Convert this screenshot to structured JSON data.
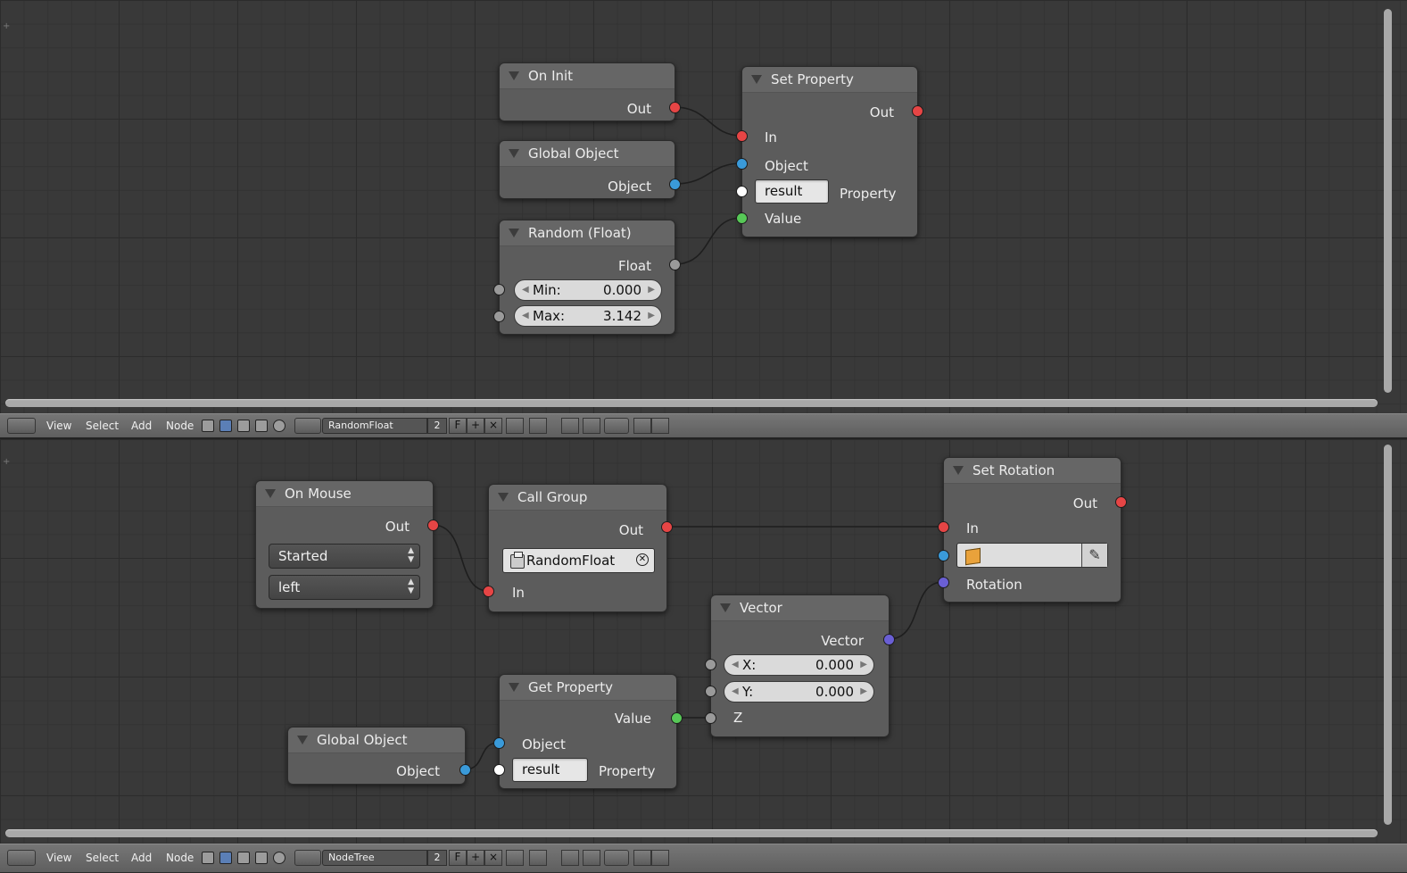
{
  "top_editor": {
    "nodes": {
      "on_init": {
        "title": "On Init",
        "out": "Out"
      },
      "global_object": {
        "title": "Global Object",
        "object": "Object"
      },
      "random_float": {
        "title": "Random (Float)",
        "float": "Float",
        "min_label": "Min:",
        "min_value": "0.000",
        "max_label": "Max:",
        "max_value": "3.142"
      },
      "set_property": {
        "title": "Set Property",
        "out": "Out",
        "in": "In",
        "object": "Object",
        "property_value": "result",
        "property": "Property",
        "value": "Value"
      }
    }
  },
  "bottom_editor": {
    "nodes": {
      "on_mouse": {
        "title": "On Mouse",
        "out": "Out",
        "event": "Started",
        "button": "left"
      },
      "call_group": {
        "title": "Call Group",
        "out": "Out",
        "group": "RandomFloat",
        "in": "In"
      },
      "set_rotation": {
        "title": "Set Rotation",
        "out": "Out",
        "in": "In",
        "rotation": "Rotation"
      },
      "vector": {
        "title": "Vector",
        "vector": "Vector",
        "x_label": "X:",
        "x_value": "0.000",
        "y_label": "Y:",
        "y_value": "0.000",
        "z": "Z"
      },
      "get_property": {
        "title": "Get Property",
        "value": "Value",
        "object": "Object",
        "property_value": "result",
        "property": "Property"
      },
      "global_object": {
        "title": "Global Object",
        "object": "Object"
      }
    }
  },
  "header_top": {
    "menu": [
      "View",
      "Select",
      "Add",
      "Node"
    ],
    "tree_name": "RandomFloat",
    "users": "2",
    "fake": "F"
  },
  "header_bottom": {
    "menu": [
      "View",
      "Select",
      "Add",
      "Node"
    ],
    "tree_name": "NodeTree",
    "users": "2",
    "fake": "F"
  },
  "colors": {
    "exec": "#e64545",
    "object": "#3a9ad9",
    "string": "#ffffff",
    "value": "#57c857",
    "float": "#9a9a9a",
    "vector": "#6a5fd4"
  }
}
